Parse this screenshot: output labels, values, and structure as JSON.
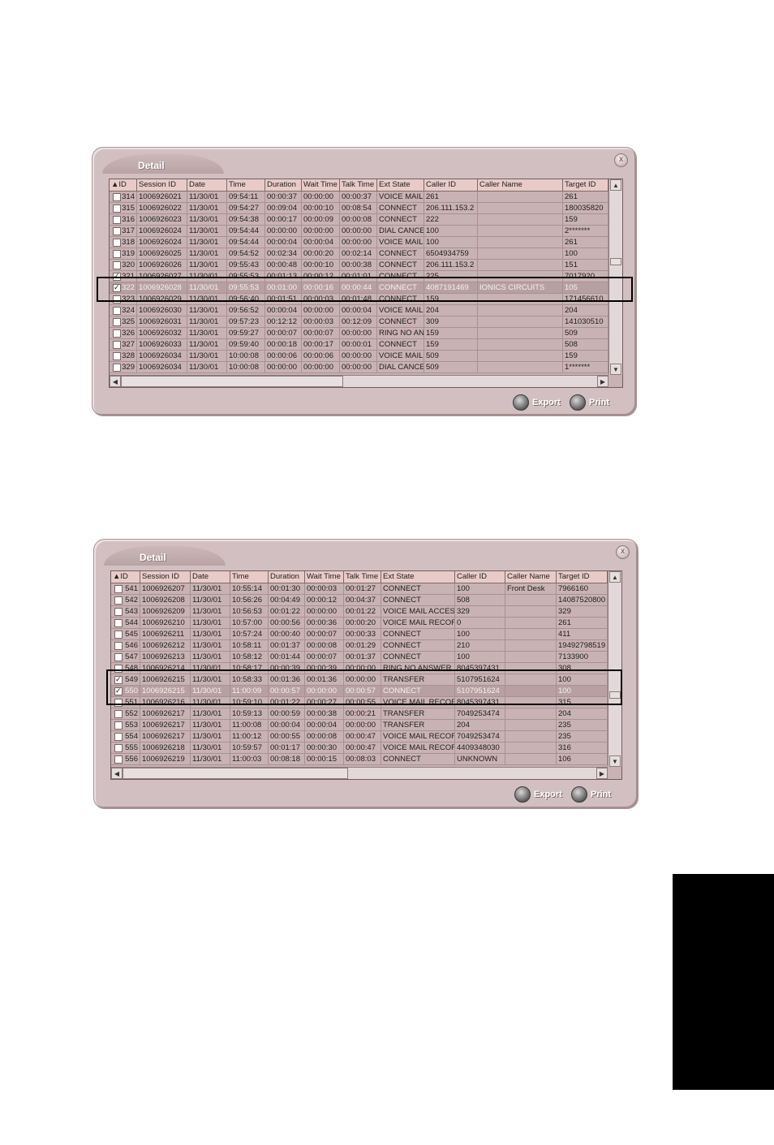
{
  "windows": [
    {
      "title": "Detail",
      "close_label": "x",
      "columns": [
        "▲ID",
        "Session ID",
        "Date",
        "Time",
        "Duration",
        "Wait Time",
        "Talk Time",
        "Ext State",
        "Caller ID",
        "Caller Name",
        "Target ID"
      ],
      "rows": [
        {
          "checked": false,
          "cells": [
            "314",
            "1006926021",
            "11/30/01",
            "09:54:11",
            "00:00:37",
            "00:00:00",
            "00:00:37",
            "VOICE MAIL",
            "261",
            "",
            "261"
          ]
        },
        {
          "checked": false,
          "cells": [
            "315",
            "1006926022",
            "11/30/01",
            "09:54:27",
            "00:09:04",
            "00:00:10",
            "00:08:54",
            "CONNECT",
            "206.111.153.2",
            "",
            "180035820"
          ]
        },
        {
          "checked": false,
          "cells": [
            "316",
            "1006926023",
            "11/30/01",
            "09:54:38",
            "00:00:17",
            "00:00:09",
            "00:00:08",
            "CONNECT",
            "222",
            "",
            "159"
          ]
        },
        {
          "checked": false,
          "cells": [
            "317",
            "1006926024",
            "11/30/01",
            "09:54:44",
            "00:00:00",
            "00:00:00",
            "00:00:00",
            "DIAL CANCE",
            "100",
            "",
            "2*******"
          ]
        },
        {
          "checked": false,
          "cells": [
            "318",
            "1006926024",
            "11/30/01",
            "09:54:44",
            "00:00:04",
            "00:00:04",
            "00:00:00",
            "VOICE MAIL",
            "100",
            "",
            "261"
          ]
        },
        {
          "checked": false,
          "cells": [
            "319",
            "1006926025",
            "11/30/01",
            "09:54:52",
            "00:02:34",
            "00:00:20",
            "00:02:14",
            "CONNECT",
            "6504934759",
            "",
            "100"
          ]
        },
        {
          "checked": false,
          "cells": [
            "320",
            "1006926026",
            "11/30/01",
            "09:55:43",
            "00:00:48",
            "00:00:10",
            "00:00:38",
            "CONNECT",
            "206.111.153.2",
            "",
            "151"
          ]
        },
        {
          "checked": true,
          "cells": [
            "321",
            "1006926027",
            "11/30/01",
            "09:55:53",
            "00:01:13",
            "00:00:12",
            "00:01:01",
            "CONNECT",
            "225",
            "",
            "7017920"
          ]
        },
        {
          "checked": true,
          "selected": true,
          "cells": [
            "322",
            "1006926028",
            "11/30/01",
            "09:55:53",
            "00:01:00",
            "00:00:16",
            "00:00:44",
            "CONNECT",
            "4087191469",
            "IONICS CIRCUITS",
            "105"
          ]
        },
        {
          "checked": false,
          "cells": [
            "323",
            "1006926029",
            "11/30/01",
            "09:56:40",
            "00:01:51",
            "00:00:03",
            "00:01:48",
            "CONNECT",
            "159",
            "",
            "171456610"
          ]
        },
        {
          "checked": false,
          "cells": [
            "324",
            "1006926030",
            "11/30/01",
            "09:56:52",
            "00:00:04",
            "00:00:00",
            "00:00:04",
            "VOICE MAIL",
            "204",
            "",
            "204"
          ]
        },
        {
          "checked": false,
          "cells": [
            "325",
            "1006926031",
            "11/30/01",
            "09:57:23",
            "00:12:12",
            "00:00:03",
            "00:12:09",
            "CONNECT",
            "309",
            "",
            "141030510"
          ]
        },
        {
          "checked": false,
          "cells": [
            "326",
            "1006926032",
            "11/30/01",
            "09:59:27",
            "00:00:07",
            "00:00:07",
            "00:00:00",
            "RING NO AN",
            "159",
            "",
            "509"
          ]
        },
        {
          "checked": false,
          "cells": [
            "327",
            "1006926033",
            "11/30/01",
            "09:59:40",
            "00:00:18",
            "00:00:17",
            "00:00:01",
            "CONNECT",
            "159",
            "",
            "508"
          ]
        },
        {
          "checked": false,
          "cells": [
            "328",
            "1006926034",
            "11/30/01",
            "10:00:08",
            "00:00:06",
            "00:00:06",
            "00:00:00",
            "VOICE MAIL",
            "509",
            "",
            "159"
          ]
        },
        {
          "checked": false,
          "cells": [
            "329",
            "1006926034",
            "11/30/01",
            "10:00:08",
            "00:00:00",
            "00:00:00",
            "00:00:00",
            "DIAL CANCE",
            "509",
            "",
            "1*******"
          ]
        }
      ],
      "export_label": "Export",
      "print_label": "Print"
    },
    {
      "title": "Detail",
      "close_label": "x",
      "columns": [
        "▲ID",
        "Session ID",
        "Date",
        "Time",
        "Duration",
        "Wait Time",
        "Talk Time",
        "Ext State",
        "Caller ID",
        "Caller Name",
        "Target ID"
      ],
      "rows": [
        {
          "checked": false,
          "cells": [
            "541",
            "1006926207",
            "11/30/01",
            "10:55:14",
            "00:01:30",
            "00:00:03",
            "00:01:27",
            "CONNECT",
            "100",
            "Front Desk",
            "7966160"
          ]
        },
        {
          "checked": false,
          "cells": [
            "542",
            "1006926208",
            "11/30/01",
            "10:56:26",
            "00:04:49",
            "00:00:12",
            "00:04:37",
            "CONNECT",
            "508",
            "",
            "14087520800"
          ]
        },
        {
          "checked": false,
          "cells": [
            "543",
            "1006926209",
            "11/30/01",
            "10:56:53",
            "00:01:22",
            "00:00:00",
            "00:01:22",
            "VOICE MAIL ACCESS",
            "329",
            "",
            "329"
          ]
        },
        {
          "checked": false,
          "cells": [
            "544",
            "1006926210",
            "11/30/01",
            "10:57:00",
            "00:00:56",
            "00:00:36",
            "00:00:20",
            "VOICE MAIL RECOR",
            "0",
            "",
            "261"
          ]
        },
        {
          "checked": false,
          "cells": [
            "545",
            "1006926211",
            "11/30/01",
            "10:57:24",
            "00:00:40",
            "00:00:07",
            "00:00:33",
            "CONNECT",
            "100",
            "",
            "411"
          ]
        },
        {
          "checked": false,
          "cells": [
            "546",
            "1006926212",
            "11/30/01",
            "10:58:11",
            "00:01:37",
            "00:00:08",
            "00:01:29",
            "CONNECT",
            "210",
            "",
            "19492798519"
          ]
        },
        {
          "checked": false,
          "cells": [
            "547",
            "1006926213",
            "11/30/01",
            "10:58:12",
            "00:01:44",
            "00:00:07",
            "00:01:37",
            "CONNECT",
            "100",
            "",
            "7133900"
          ]
        },
        {
          "checked": false,
          "cells": [
            "548",
            "1006926214",
            "11/30/01",
            "10:58:17",
            "00:00:39",
            "00:00:39",
            "00:00:00",
            "RING NO ANSWER",
            "8045397431",
            "",
            "308"
          ]
        },
        {
          "checked": true,
          "cells": [
            "549",
            "1006926215",
            "11/30/01",
            "10:58:33",
            "00:01:36",
            "00:01:36",
            "00:00:00",
            "TRANSFER",
            "5107951624",
            "",
            "100"
          ]
        },
        {
          "checked": true,
          "selected": true,
          "cells": [
            "550",
            "1006926215",
            "11/30/01",
            "11:00:09",
            "00:00:57",
            "00:00:00",
            "00:00:57",
            "CONNECT",
            "5107951624",
            "",
            "100"
          ]
        },
        {
          "checked": false,
          "cells": [
            "551",
            "1006926216",
            "11/30/01",
            "10:59:10",
            "00:01:22",
            "00:00:27",
            "00:00:55",
            "VOICE MAIL RECOR",
            "8045397431",
            "",
            "315"
          ]
        },
        {
          "checked": false,
          "cells": [
            "552",
            "1006926217",
            "11/30/01",
            "10:59:13",
            "00:00:59",
            "00:00:38",
            "00:00:21",
            "TRANSFER",
            "7049253474",
            "",
            "204"
          ]
        },
        {
          "checked": false,
          "cells": [
            "553",
            "1006926217",
            "11/30/01",
            "11:00:08",
            "00:00:04",
            "00:00:04",
            "00:00:00",
            "TRANSFER",
            "204",
            "",
            "235"
          ]
        },
        {
          "checked": false,
          "cells": [
            "554",
            "1006926217",
            "11/30/01",
            "11:00:12",
            "00:00:55",
            "00:00:08",
            "00:00:47",
            "VOICE MAIL RECOR",
            "7049253474",
            "",
            "235"
          ]
        },
        {
          "checked": false,
          "cells": [
            "555",
            "1006926218",
            "11/30/01",
            "10:59:57",
            "00:01:17",
            "00:00:30",
            "00:00:47",
            "VOICE MAIL RECOR",
            "4409348030",
            "",
            "316"
          ]
        },
        {
          "checked": false,
          "cells": [
            "556",
            "1006926219",
            "11/30/01",
            "11:00:03",
            "00:08:18",
            "00:00:15",
            "00:08:03",
            "CONNECT",
            "UNKNOWN",
            "",
            "106"
          ]
        }
      ],
      "export_label": "Export",
      "print_label": "Print"
    }
  ]
}
